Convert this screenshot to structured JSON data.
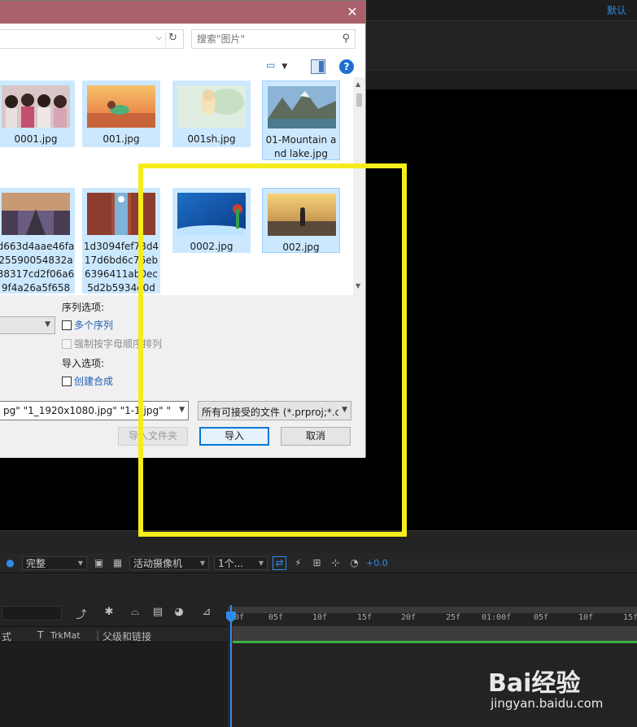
{
  "ae": {
    "workspace_label": "默认",
    "viewer": {
      "resolution": "完整",
      "camera": "活动摄像机",
      "views": "1个...",
      "exposure": "+0.0"
    },
    "timeline": {
      "col_mode": "式",
      "col_t": "T",
      "col_trkmat": "TrkMat",
      "col_parent": "父级和链接",
      "ruler_ticks": [
        "0f",
        "05f",
        "10f",
        "15f",
        "20f",
        "25f",
        "01:00f",
        "05f",
        "10f",
        "15f"
      ]
    },
    "colors": {
      "accent": "#2d8ceb",
      "work_area": "#3db043"
    }
  },
  "dialog": {
    "close_glyph": "✕",
    "address_chevron": "⌵",
    "refresh_glyph": "↻",
    "search": {
      "placeholder": "搜索\"图片\""
    },
    "files": [
      {
        "name": "0001.jpg"
      },
      {
        "name": "001.jpg"
      },
      {
        "name": "001sh.jpg"
      },
      {
        "name": "01-Mountain and lake.jpg"
      },
      {
        "name": "d663d4aae46fa25590054832a38317cd2f06a69f4a26a5f658f..."
      },
      {
        "name": "1d3094fef78d417d6bd6c76eb6396411ab0ec5d2b5934e0d6..."
      },
      {
        "name": "0002.jpg"
      },
      {
        "name": "002.jpg"
      }
    ],
    "options": {
      "sequence_heading": "序列选项:",
      "multiple_sequences": "多个序列",
      "force_alpha": "强制按字母顺序排列",
      "import_heading": "导入选项:",
      "create_comp": "创建合成"
    },
    "filename_value": "pg\" \"1_1920x1080.jpg\" \"1-1.jpg\" \"1-",
    "filetype_value": "所有可接受的文件 (*.prproj;*.c",
    "buttons": {
      "import_folder": "导入文件夹",
      "import": "导入",
      "cancel": "取消"
    },
    "title_color": "#a9606b"
  },
  "watermark": {
    "logo": "Bai经验",
    "url": "jingyan.baidu.com"
  },
  "highlight_color": "#f6ec1b"
}
